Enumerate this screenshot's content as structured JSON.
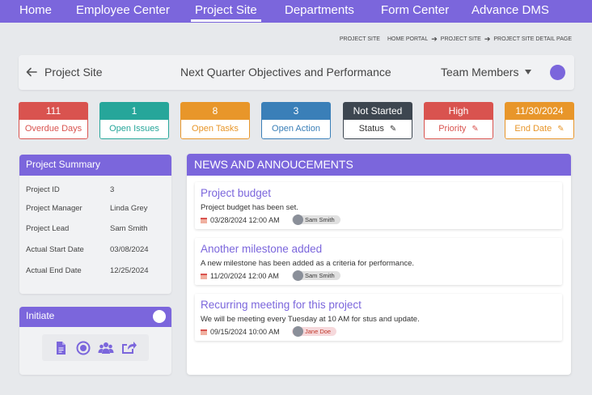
{
  "nav": {
    "items": [
      "Home",
      "Employee Center",
      "Project Site",
      "Departments",
      "Form Center",
      "Advance DMS"
    ],
    "active": "Project Site"
  },
  "breadcrumb": [
    "PROJECT SITE",
    "HOME PORTAL",
    "PROJECT SITE",
    "PROJECT SITE DETAIL PAGE"
  ],
  "header": {
    "title": "Project Site",
    "center": "Next Quarter Objectives and Performance",
    "team_members": "Team Members"
  },
  "stats": [
    {
      "value": "111",
      "label": "Overdue Days",
      "color": "#d9534f"
    },
    {
      "value": "1",
      "label": "Open Issues",
      "color": "#26a69a"
    },
    {
      "value": "8",
      "label": "Open Tasks",
      "color": "#e8962a"
    },
    {
      "value": "3",
      "label": "Open Action",
      "color": "#3a7fb8"
    },
    {
      "value": "Not Started",
      "label": "Status",
      "color": "#3d4650"
    },
    {
      "value": "High",
      "label": "Priority",
      "color": "#d9534f"
    },
    {
      "value": "11/30/2024",
      "label": "End Date",
      "color": "#e8962a"
    }
  ],
  "summary": {
    "title": "Project Summary",
    "rows": [
      {
        "label": "Project ID",
        "value": "3"
      },
      {
        "label": "Project Manager",
        "value": "Linda Grey"
      },
      {
        "label": "Project Lead",
        "value": "Sam Smith"
      },
      {
        "label": "Actual Start Date",
        "value": "03/08/2024"
      },
      {
        "label": "Actual End Date",
        "value": "12/25/2024"
      }
    ]
  },
  "initiate": {
    "title": "Initiate",
    "actions": [
      "document-icon",
      "record-icon",
      "group-icon",
      "share-icon"
    ]
  },
  "news": {
    "title": "NEWS AND ANNOUCEMENTS",
    "items": [
      {
        "title": "Project budget",
        "desc": "Project budget has been set.",
        "date": "03/28/2024 12:00 AM",
        "user": "Sam Smith"
      },
      {
        "title": "Another milestone added",
        "desc": "A new milestone has been added as a criteria for performance.",
        "date": "11/20/2024 12:00 AM",
        "user": "Sam Smith"
      },
      {
        "title": "Recurring meeting for this project",
        "desc": "We will be meeting every Tuesday at 10 AM for stus and update.",
        "date": "09/15/2024 10:00 AM",
        "user": "Jane Doe"
      }
    ]
  },
  "colors": {
    "accent": "#7b66dc"
  }
}
